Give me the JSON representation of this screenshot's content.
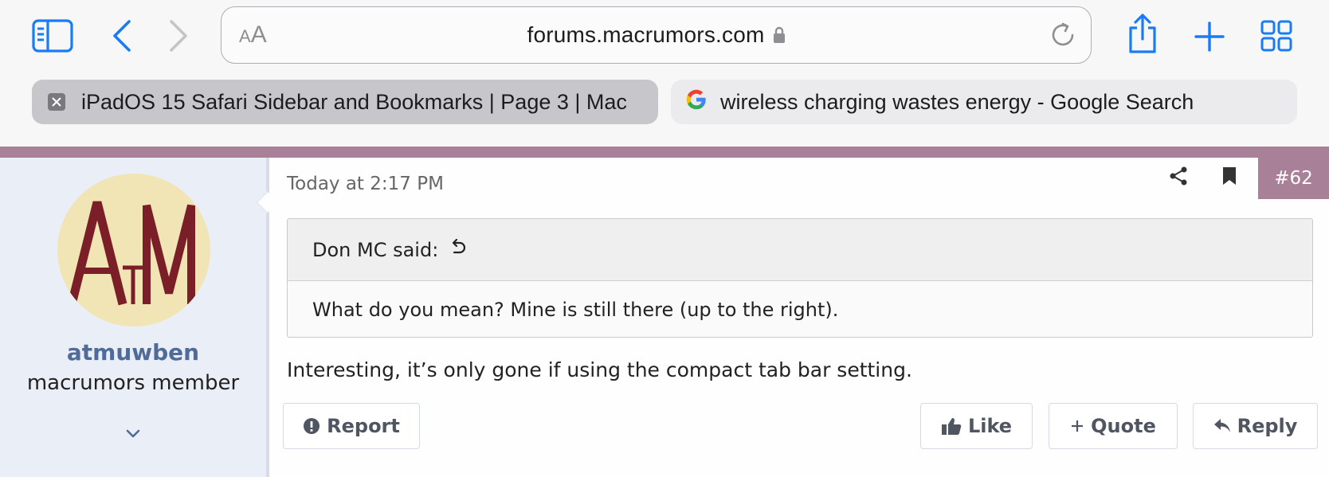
{
  "toolbar": {
    "icons": [
      "sidebar-icon",
      "back-icon",
      "forward-icon",
      "share-icon",
      "new-tab-icon",
      "tab-overview-icon"
    ],
    "reader_text_small": "A",
    "reader_text_large": "A",
    "url": "forums.macrumors.com"
  },
  "tabs": [
    {
      "label": "iPadOS 15 Safari Sidebar and Bookmarks | Page 3 | Mac",
      "active": true
    },
    {
      "label": "wireless charging wastes energy - Google Search",
      "active": false
    }
  ],
  "post": {
    "accent_color": "#a88097",
    "username": "atmuwben",
    "user_title": "macrumors member",
    "avatar_text": "AtM",
    "timestamp": "Today at 2:17 PM",
    "number": "#62",
    "quote": {
      "author_line": "Don MC said:",
      "body": "What do you mean? Mine is still there (up to the right)."
    },
    "body": "Interesting, it’s only gone if using the compact tab bar setting.",
    "actions": {
      "report": "Report",
      "like": "Like",
      "quote": "Quote",
      "reply": "Reply"
    }
  }
}
